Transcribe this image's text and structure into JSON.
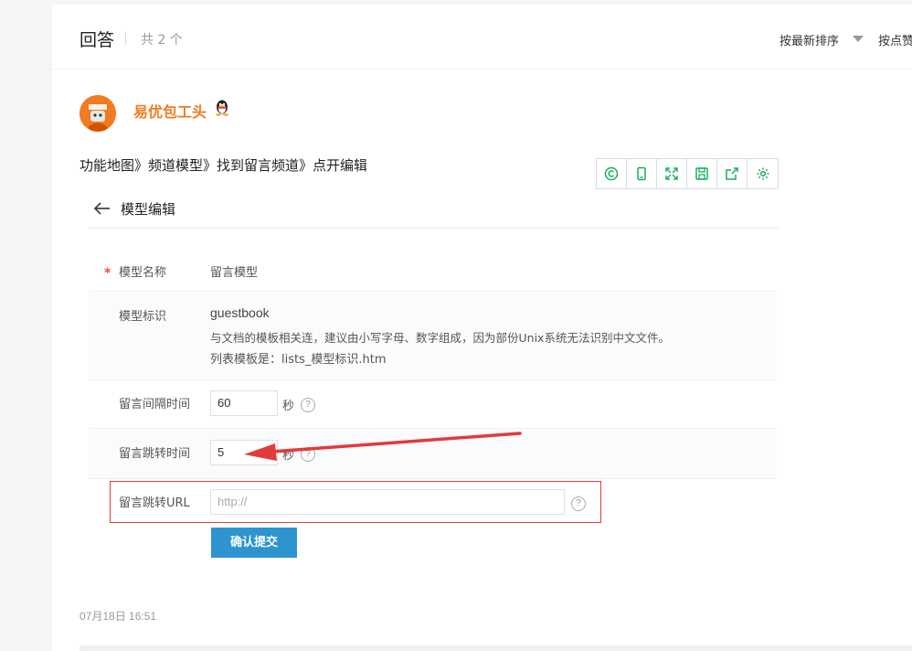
{
  "header": {
    "title": "回答",
    "count": "共 2 个",
    "sort_latest": "按最新排序",
    "sort_likes": "按点赞"
  },
  "answer": {
    "username": "易优包工头",
    "text": "功能地图》频道模型》找到留言频道》点开编辑",
    "date": "07月18日 16:51"
  },
  "screenshot": {
    "toolbar_icons": [
      "copyright-icon",
      "mobile-icon",
      "fullscreen-icon",
      "save-icon",
      "share-icon",
      "settings-icon"
    ],
    "page_title": "模型编辑",
    "rows": {
      "model_name": {
        "label": "模型名称",
        "value": "留言模型"
      },
      "model_id": {
        "label": "模型标识",
        "value": "guestbook",
        "hint1": "与文档的模板相关连，建议由小写字母、数字组成，因为部份Unix系统无法识别中文文件。",
        "hint2": "列表模板是：lists_模型标识.htm"
      },
      "interval": {
        "label": "留言间隔时间",
        "value": "60",
        "unit": "秒"
      },
      "redirect_time": {
        "label": "留言跳转时间",
        "value": "5",
        "unit": "秒"
      },
      "redirect_url": {
        "label": "留言跳转URL",
        "placeholder": "http://"
      }
    },
    "submit_label": "确认提交",
    "help_glyph": "?",
    "required_mark": "*"
  },
  "colors": {
    "accent_orange": "#f07b21",
    "submit_blue": "#2e94cf",
    "toolbar_green": "#1aad5b",
    "annotation_red": "#e33a3a"
  }
}
